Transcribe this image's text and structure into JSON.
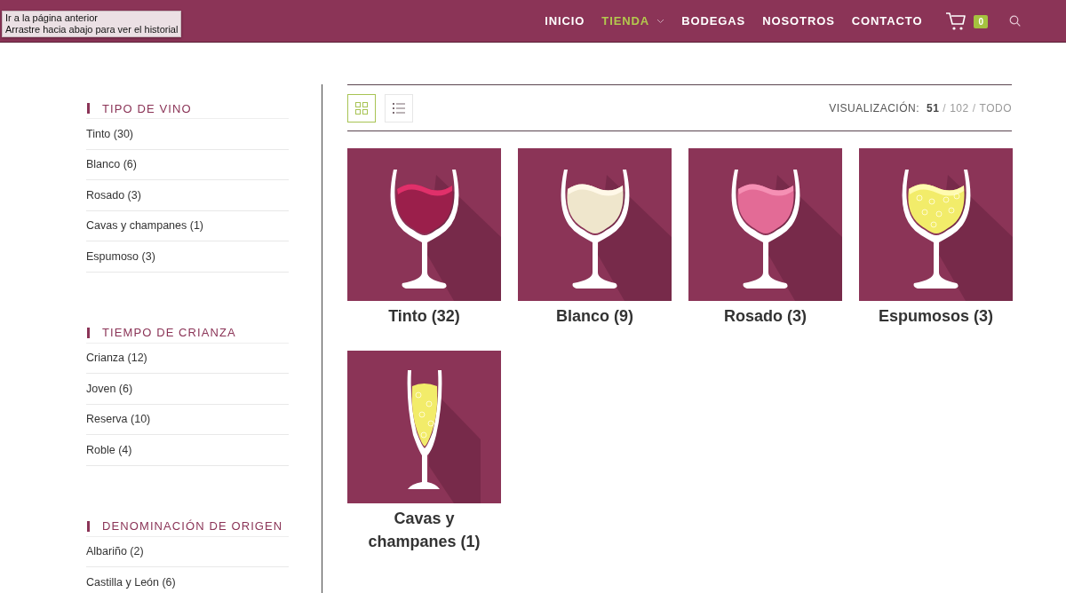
{
  "tooltip": {
    "lines": [
      "Ir a la página anterior",
      "Arrastre hacia abajo para ver el historial"
    ]
  },
  "nav": {
    "items": [
      {
        "label": "INICIO",
        "selected": false,
        "dropdown": false
      },
      {
        "label": "TIENDA",
        "selected": true,
        "dropdown": true
      },
      {
        "label": "BODEGAS",
        "selected": false,
        "dropdown": false
      },
      {
        "label": "NOSOTROS",
        "selected": false,
        "dropdown": false
      },
      {
        "label": "CONTACTO",
        "selected": false,
        "dropdown": false
      }
    ],
    "cart_count": "0"
  },
  "sidebar": [
    {
      "title": "TIPO DE VINO",
      "items": [
        "Tinto (30)",
        "Blanco (6)",
        "Rosado (3)",
        "Cavas y champanes (1)",
        "Espumoso (3)"
      ]
    },
    {
      "title": "TIEMPO DE CRIANZA",
      "items": [
        "Crianza (12)",
        "Joven (6)",
        "Reserva (10)",
        "Roble (4)"
      ]
    },
    {
      "title": "DENOMINACIÓN DE ORIGEN",
      "items": [
        "Albariño (2)",
        "Castilla y León (6)"
      ]
    }
  ],
  "toolbar": {
    "views": [
      {
        "kind": "grid",
        "selected": true
      },
      {
        "kind": "list",
        "selected": false
      }
    ],
    "label": "VISUALIZACIÓN:",
    "separator": "/",
    "per_page": [
      {
        "label": "51",
        "selected": true
      },
      {
        "label": "102",
        "selected": false
      },
      {
        "label": "TODO",
        "selected": false
      }
    ]
  },
  "categories": [
    {
      "name": "Tinto (32)",
      "kind": "tinto"
    },
    {
      "name": "Blanco (9)",
      "kind": "blanco"
    },
    {
      "name": "Rosado (3)",
      "kind": "rosado"
    },
    {
      "name": "Espumosos (3)",
      "kind": "espumoso"
    },
    {
      "name": "Cavas y champanes (1)",
      "kind": "cava"
    }
  ]
}
